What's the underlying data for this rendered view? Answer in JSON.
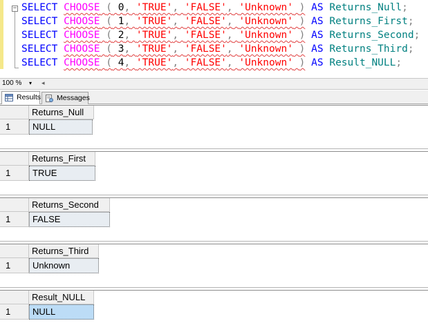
{
  "editor": {
    "lines": [
      {
        "kw": "SELECT",
        "fn": "CHOOSE",
        "open": "(",
        "index": "0",
        "args": [
          "'TRUE'",
          "'FALSE'",
          "'Unknown'"
        ],
        "close": ")",
        "as": "AS",
        "alias": "Returns_Null",
        "end": ";"
      },
      {
        "kw": "SELECT",
        "fn": "CHOOSE",
        "open": "(",
        "index": "1",
        "args": [
          "'TRUE'",
          "'FALSE'",
          "'Unknown'"
        ],
        "close": ")",
        "as": "AS",
        "alias": "Returns_First",
        "end": ";"
      },
      {
        "kw": "SELECT",
        "fn": "CHOOSE",
        "open": "(",
        "index": "2",
        "args": [
          "'TRUE'",
          "'FALSE'",
          "'Unknown'"
        ],
        "close": ")",
        "as": "AS",
        "alias": "Returns_Second",
        "end": ";"
      },
      {
        "kw": "SELECT",
        "fn": "CHOOSE",
        "open": "(",
        "index": "3",
        "args": [
          "'TRUE'",
          "'FALSE'",
          "'Unknown'"
        ],
        "close": ")",
        "as": "AS",
        "alias": "Returns_Third",
        "end": ";"
      },
      {
        "kw": "SELECT",
        "fn": "CHOOSE",
        "open": "(",
        "index": "4",
        "args": [
          "'TRUE'",
          "'FALSE'",
          "'Unknown'"
        ],
        "close": ")",
        "as": "AS",
        "alias": "Result_NULL",
        "end": ";"
      }
    ],
    "fold_glyph": "−"
  },
  "zoom": {
    "value": "100 %",
    "arrow": "▾",
    "scroll": "◂"
  },
  "tabs": [
    {
      "label": "Results",
      "active": true
    },
    {
      "label": "Messages",
      "active": false
    }
  ],
  "grids": [
    {
      "column": "Returns_Null",
      "row": "1",
      "value": "NULL",
      "selected": false
    },
    {
      "column": "Returns_First",
      "row": "1",
      "value": "TRUE",
      "selected": false
    },
    {
      "column": "Returns_Second",
      "row": "1",
      "value": "FALSE",
      "selected": false
    },
    {
      "column": "Returns_Third",
      "row": "1",
      "value": "Unknown",
      "selected": false
    },
    {
      "column": "Result_NULL",
      "row": "1",
      "value": "NULL",
      "selected": true
    }
  ],
  "colors": {
    "keyword": "#0000ff",
    "function": "#ff00ff",
    "string": "#ff0000",
    "identifier": "#008080",
    "selection": "#bcdcf6"
  }
}
